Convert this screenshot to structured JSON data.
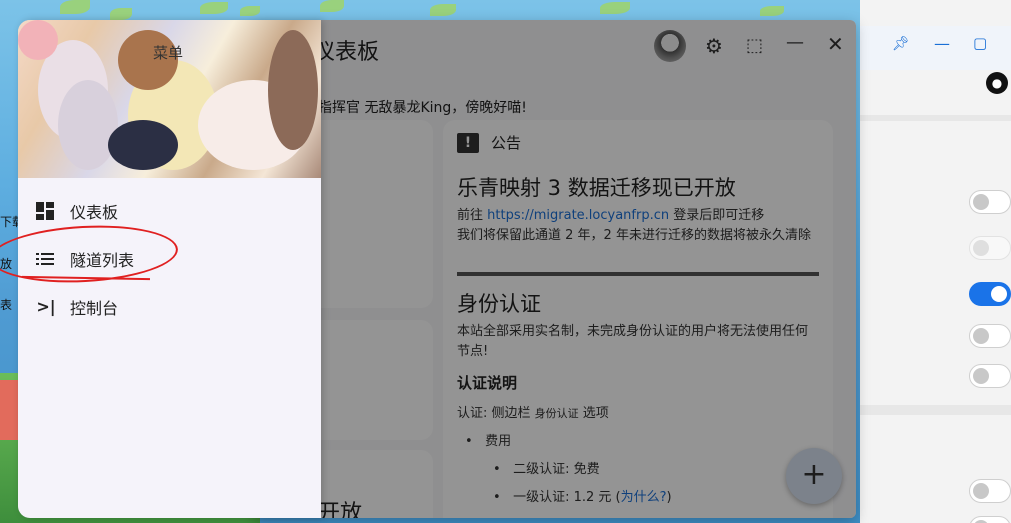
{
  "app": {
    "title": "仪表板",
    "greeting": "指挥官 无敌暴龙King，傍晚好喵!",
    "bottom_title": "开放"
  },
  "header_icons": [
    "avatar",
    "gear-icon",
    "fullscreen-icon",
    "minimize-icon",
    "close-icon"
  ],
  "notice": {
    "heading": "公告",
    "h1": "乐青映射 3 数据迁移现已开放",
    "p1_prefix": "前往 ",
    "p1_link": "https://migrate.locyanfrp.cn",
    "p1_suffix": " 登录后即可迁移",
    "p2": "我们将保留此通道 2 年，2 年未进行迁移的数据将被永久清除",
    "h2": "身份认证",
    "p3": "本站全部采用实名制，未完成身份认证的用户将无法使用任何节点!",
    "h3": "认证说明",
    "auth_prefix": "认证: 侧边栏 ",
    "auth_small": "身份认证",
    "auth_suffix": " 选项",
    "fee_label": "费用",
    "level2": "二级认证: 免费",
    "level1_prefix": "一级认证: 1.2 元 (",
    "level1_link": "为什么?",
    "level1_suffix": ")"
  },
  "fab_label": "+",
  "drawer": {
    "title": "菜单",
    "items": [
      {
        "label": "仪表板",
        "icon": "dashboard-icon"
      },
      {
        "label": "隧道列表",
        "icon": "list-icon"
      },
      {
        "label": "控制台",
        "icon": "terminal-icon"
      }
    ]
  },
  "edge_texts": [
    "下载",
    "放",
    "表"
  ],
  "behind_window": {
    "pin_icon": "pin-icon",
    "toggles": [
      "off",
      "disabled",
      "on",
      "off",
      "off",
      "off",
      "off"
    ]
  },
  "colors": {
    "accent": "#1a73e8",
    "link": "#1a6fd6",
    "annotation": "#e02020"
  }
}
